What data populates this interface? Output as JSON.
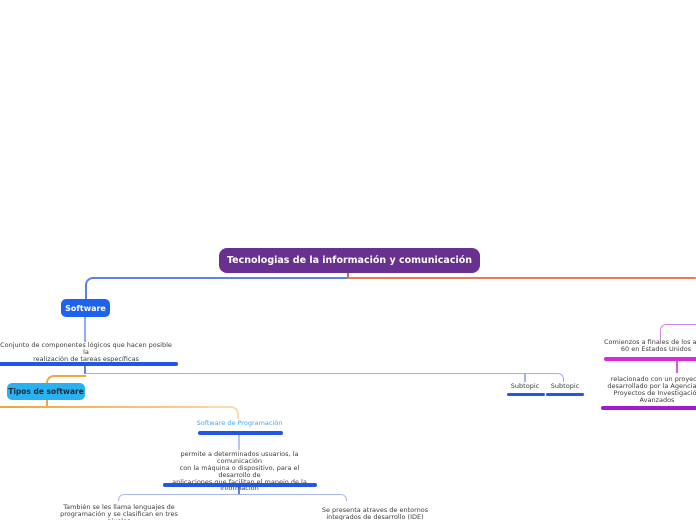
{
  "root_topic": {
    "label": "Tecnologias de la información y comunicación"
  },
  "software_branch": {
    "software": {
      "label": "Software"
    },
    "software_description": {
      "lines": [
        "Conjunto de componentes lógicos que hacen posible la",
        "realización de tareas específicas"
      ]
    },
    "tipos_de_software": {
      "label": "Tipos de software"
    },
    "subtopics": [
      {
        "label": "Subtopic"
      },
      {
        "label": "Subtopic"
      }
    ],
    "software_programacion": {
      "label": "Software de Programación"
    },
    "programacion_description": {
      "lines": [
        "permite a determinados usuarios, la comunicación",
        "con la máquina o dispositivo, para el desarrollo de",
        "aplicaciones que facilitan el manejo de la",
        "información"
      ]
    },
    "lenguajes": {
      "lines": [
        "También se les llama lenguajes de",
        "programación y se clasifican en tres",
        "niveles"
      ]
    },
    "ide": {
      "lines": [
        "Se presenta atraves de entornos",
        "integrados de desarrollo (IDE)"
      ]
    }
  },
  "history_branch": {
    "comienzos": {
      "lines": [
        "Comienzos a finales de los años",
        "60 en Estados Unidos"
      ]
    },
    "proyecto": {
      "lines": [
        "relacionado con un proyecto",
        "desarrollado por la Agencia de",
        "Proyectos de Investigación",
        "Avanzados"
      ]
    }
  },
  "colors": {
    "root_bg": "#68318f",
    "software_bg": "#1e63ee",
    "tipos_bg": "#29b2f2",
    "underline_blue": "#2156e8",
    "line_blue": "#5b82ea",
    "line_periwinkle": "#9fb1f2",
    "line_orange_main": "#ec7a50",
    "line_orange_branch": "#f2a63b",
    "line_peach": "#f8dcae",
    "line_orchid": "#cf8ae8",
    "underline_magenta": "#d92ad9",
    "underline_violet": "#a21ad6",
    "programacion_label": "#4da6e8",
    "text": "#3c3c3c"
  }
}
